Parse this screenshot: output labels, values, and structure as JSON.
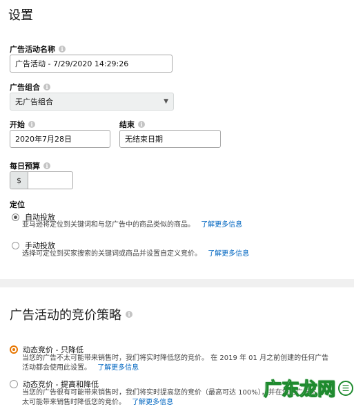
{
  "header": {
    "title": "设置"
  },
  "campaign_name": {
    "label": "广告活动名称",
    "value": "广告活动 - 7/29/2020 14:29:26"
  },
  "portfolio": {
    "label": "广告组合",
    "value": "无广告组合"
  },
  "start": {
    "label": "开始",
    "value": "2020年7月28日"
  },
  "end": {
    "label": "结束",
    "value": "无结束日期"
  },
  "budget": {
    "label": "每日预算",
    "currency": "$",
    "value": ""
  },
  "targeting": {
    "label": "定位",
    "options": [
      {
        "label": "自动投放",
        "desc": "亚马逊将定位到关键词和与您广告中的商品类似的商品。",
        "link": "了解更多信息",
        "selected": true
      },
      {
        "label": "手动投放",
        "desc": "选择可定位到买家搜索的关键词或商品并设置自定义竞价。",
        "link": "了解更多信息",
        "selected": false
      }
    ]
  },
  "bidding": {
    "title": "广告活动的竞价策略",
    "options": [
      {
        "label": "动态竞价 - 只降低",
        "desc1": "当您的广告不太可能带来销售时，我们将实时降低您的竞价。 在 2019 年 01 月之前创建的任何广告",
        "desc2": "活动都会使用此设置。",
        "link": "了解更多信息",
        "selected": true
      },
      {
        "label": "动态竞价 - 提高和降低",
        "desc1": "当您的广告很有可能带来销售时，我们将实时提高您的竞价（最高可达 100%），并在您的广告不",
        "desc2": "太可能带来销售时降低您的竞价。",
        "link": "了解更多信息",
        "selected": false
      }
    ]
  },
  "watermark": {
    "text": "广东龙网",
    "icon": "dragon-logo-icon"
  },
  "colors": {
    "accent": "#e77600",
    "link": "#0066c0",
    "info": "#c4c4c4"
  }
}
